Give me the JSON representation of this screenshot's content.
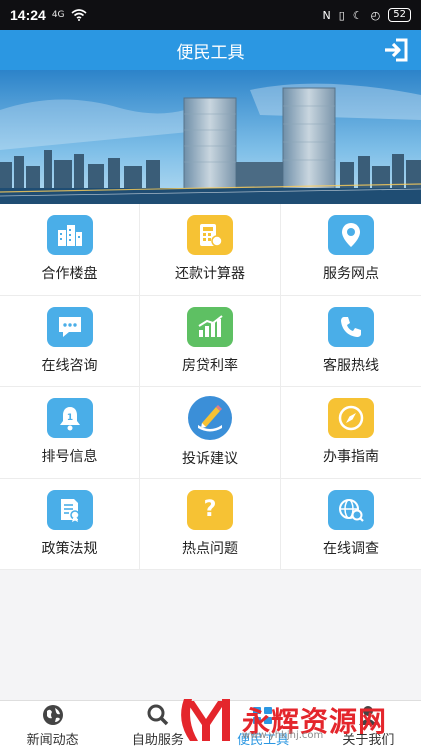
{
  "status_bar": {
    "time": "14:24",
    "signal": "4G",
    "battery": "52"
  },
  "header": {
    "title": "便民工具"
  },
  "tools": [
    {
      "label": "合作楼盘",
      "icon": "buildings-icon",
      "color": "#4aaee8"
    },
    {
      "label": "还款计算器",
      "icon": "calculator-icon",
      "color": "#f6c234"
    },
    {
      "label": "服务网点",
      "icon": "location-pin-icon",
      "color": "#4aaee8"
    },
    {
      "label": "在线咨询",
      "icon": "chat-bubble-icon",
      "color": "#4aaee8"
    },
    {
      "label": "房贷利率",
      "icon": "bar-chart-icon",
      "color": "#5ec063"
    },
    {
      "label": "客服热线",
      "icon": "phone-icon",
      "color": "#4aaee8"
    },
    {
      "label": "排号信息",
      "icon": "bell-number-icon",
      "color": "#4aaee8"
    },
    {
      "label": "投诉建议",
      "icon": "pen-icon",
      "color": "#4aaee8"
    },
    {
      "label": "办事指南",
      "icon": "compass-icon",
      "color": "#f6c234"
    },
    {
      "label": "政策法规",
      "icon": "document-icon",
      "color": "#4aaee8"
    },
    {
      "label": "热点问题",
      "icon": "question-icon",
      "color": "#f6c234"
    },
    {
      "label": "在线调查",
      "icon": "globe-search-icon",
      "color": "#4aaee8"
    }
  ],
  "bottom_nav": [
    {
      "label": "新闻动态",
      "icon": "globe-icon"
    },
    {
      "label": "自助服务",
      "icon": "search-icon"
    },
    {
      "label": "便民工具",
      "icon": "tools-icon"
    },
    {
      "label": "关于我们",
      "icon": "user-icon"
    }
  ],
  "watermark": {
    "text": "永辉资源网",
    "url": "www.yhkjhj.com"
  }
}
